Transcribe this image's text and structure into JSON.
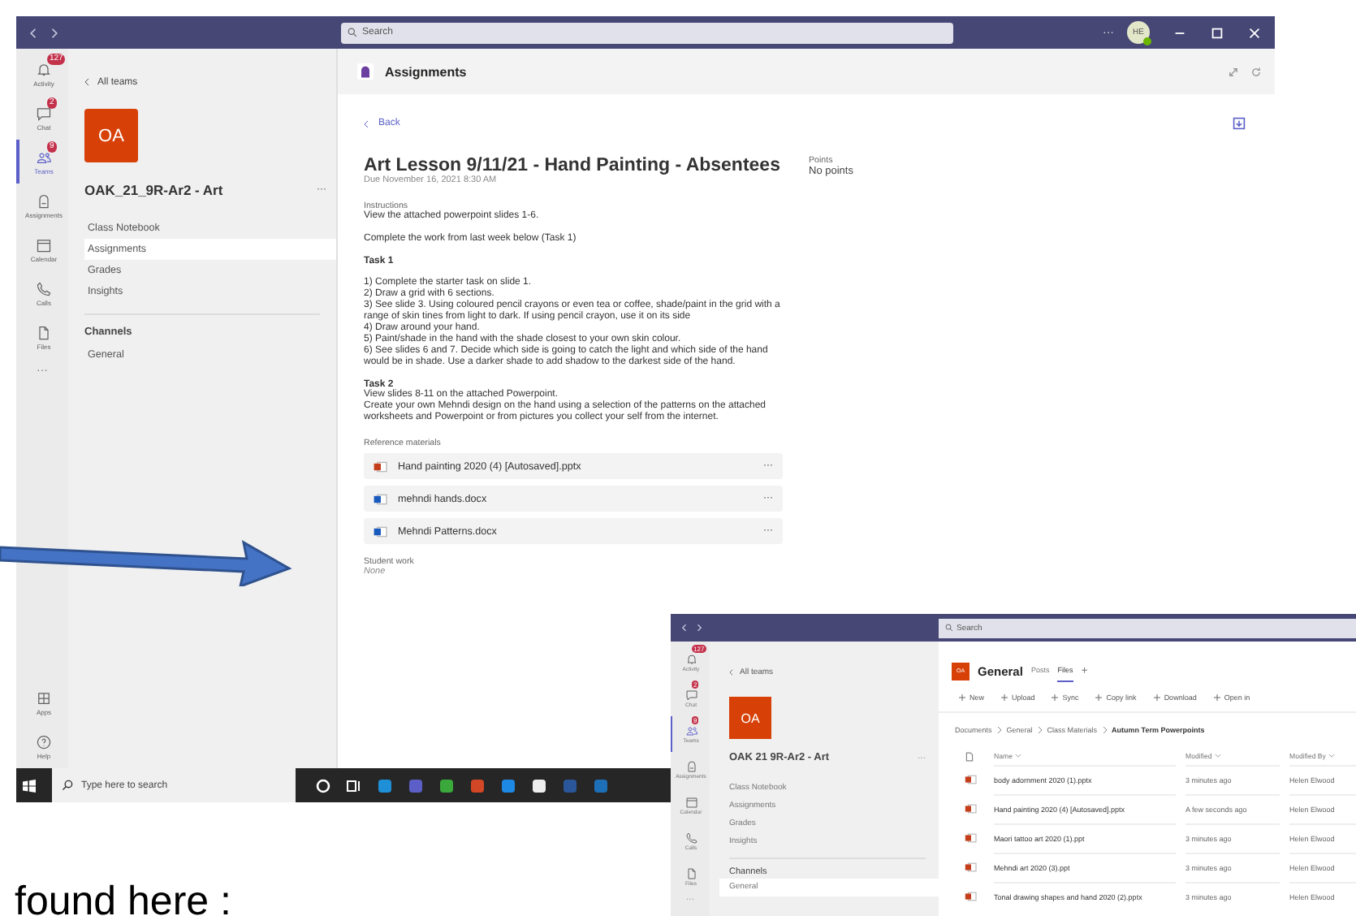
{
  "main_window": {
    "title_bar": {
      "search_placeholder": "Search",
      "more": "···",
      "avatar": "HE"
    },
    "rail": [
      {
        "label": "Activity",
        "badge": "127",
        "selected": false
      },
      {
        "label": "Chat",
        "badge": "2",
        "selected": false
      },
      {
        "label": "Teams",
        "badge": "9",
        "selected": true
      },
      {
        "label": "Assignments",
        "selected": false
      },
      {
        "label": "Calendar",
        "selected": false
      },
      {
        "label": "Calls",
        "selected": false
      },
      {
        "label": "Files",
        "selected": false
      }
    ],
    "rail_more": "···",
    "rail_bottom": [
      {
        "label": "Apps"
      },
      {
        "label": "Help"
      }
    ],
    "team_panel": {
      "back": "All teams",
      "avatar": "OA",
      "team_name": "OAK_21_9R-Ar2 - Art",
      "more": "···",
      "items": [
        {
          "label": "Class Notebook",
          "selected": false
        },
        {
          "label": "Assignments",
          "selected": true
        },
        {
          "label": "Grades",
          "selected": false
        },
        {
          "label": "Insights",
          "selected": false
        }
      ],
      "channels_heading": "Channels",
      "channels": [
        {
          "label": "General",
          "selected": false
        }
      ]
    },
    "app_header": {
      "title": "Assignments"
    },
    "assignment": {
      "back": "Back",
      "title": "Art Lesson 9/11/21 - Hand Painting - Absentees",
      "due": "Due November 16, 2021 8:30 AM",
      "points_label": "Points",
      "points": "No points",
      "instructions_label": "Instructions",
      "paragraphs": [
        {
          "lines": [
            "View the attached powerpoint slides 1-6."
          ]
        },
        {
          "lines": [
            "Complete the work from last week below (Task 1)"
          ]
        },
        {
          "heading": "Task 1"
        },
        {
          "lines": [
            "1) Complete the starter task on slide 1.",
            "2) Draw a grid with 6 sections.",
            "3) See slide 3. Using coloured pencil crayons or even tea or coffee, shade/paint in the grid with a range of skin tines from light to dark.  If using pencil crayon, use it on its side",
            "4) Draw around your hand.",
            "5) Paint/shade in the hand with the shade closest to your own skin colour.",
            "6) See slides 6 and 7. Decide which side is going to catch the light and which side of the hand would be in shade.  Use a darker shade to add shadow to the darkest side of the hand."
          ]
        },
        {
          "heading": "Task 2",
          "lines": [
            "View slides 8-11 on the attached Powerpoint.",
            "Create your own Mehndi design on the hand using a selection of the patterns on the attached worksheets and Powerpoint or from pictures you collect your self from the internet."
          ]
        }
      ],
      "reference_label": "Reference materials",
      "files": [
        {
          "name": "Hand painting 2020 (4) [Autosaved].pptx",
          "kind": "pptx",
          "more": "···"
        },
        {
          "name": "mehndi hands.docx",
          "kind": "docx",
          "more": "···"
        },
        {
          "name": "Mehndi Patterns.docx",
          "kind": "docx",
          "more": "···"
        }
      ],
      "student_work_label": "Student work",
      "student_work": "None"
    },
    "taskbar": {
      "search_placeholder": "Type here to search"
    }
  },
  "inset_window": {
    "title_bar": {
      "search_placeholder": "Search"
    },
    "rail": [
      {
        "label": "Activity",
        "badge": "127",
        "selected": false
      },
      {
        "label": "Chat",
        "badge": "2",
        "selected": false
      },
      {
        "label": "Teams",
        "badge": "9",
        "selected": true
      },
      {
        "label": "Assignments",
        "selected": false
      },
      {
        "label": "Calendar",
        "selected": false
      },
      {
        "label": "Calls",
        "selected": false
      },
      {
        "label": "Files",
        "selected": false
      }
    ],
    "rail_more": "···",
    "team_panel": {
      "back": "All teams",
      "avatar": "OA",
      "team_name": "OAK 21 9R-Ar2 - Art",
      "more": "···",
      "items": [
        {
          "label": "Class Notebook",
          "selected": false
        },
        {
          "label": "Assignments",
          "selected": false
        },
        {
          "label": "Grades",
          "selected": false
        },
        {
          "label": "Insights",
          "selected": false
        }
      ],
      "channels_heading": "Channels",
      "channels": [
        {
          "label": "General",
          "selected": true
        }
      ]
    },
    "channel": {
      "avatar": "OA",
      "name": "General",
      "tabs": [
        {
          "label": "Posts",
          "selected": false
        },
        {
          "label": "Files",
          "selected": true
        }
      ],
      "add": "+"
    },
    "toolbar": [
      "New",
      "Upload",
      "Sync",
      "Copy link",
      "Download",
      "Open in"
    ],
    "breadcrumb": [
      "Documents",
      "General",
      "Class Materials",
      "Autumn Term Powerpoints"
    ],
    "columns": [
      "Name",
      "Modified",
      "Modified By"
    ],
    "rows": [
      {
        "name": "body adornment 2020 (1).pptx",
        "modified": "3 minutes ago",
        "modified_by": "Helen Elwood"
      },
      {
        "name": "Hand painting 2020 (4) [Autosaved].pptx",
        "modified": "A few seconds ago",
        "modified_by": "Helen Elwood"
      },
      {
        "name": "Maori tattoo art 2020 (1).ppt",
        "modified": "3 minutes ago",
        "modified_by": "Helen Elwood"
      },
      {
        "name": "Mehndi art 2020 (3).ppt",
        "modified": "3 minutes ago",
        "modified_by": "Helen Elwood"
      },
      {
        "name": "Tonal drawing shapes and hand 2020 (2).pptx",
        "modified": "3 minutes ago",
        "modified_by": "Helen Elwood"
      }
    ]
  },
  "caption": "found here :"
}
